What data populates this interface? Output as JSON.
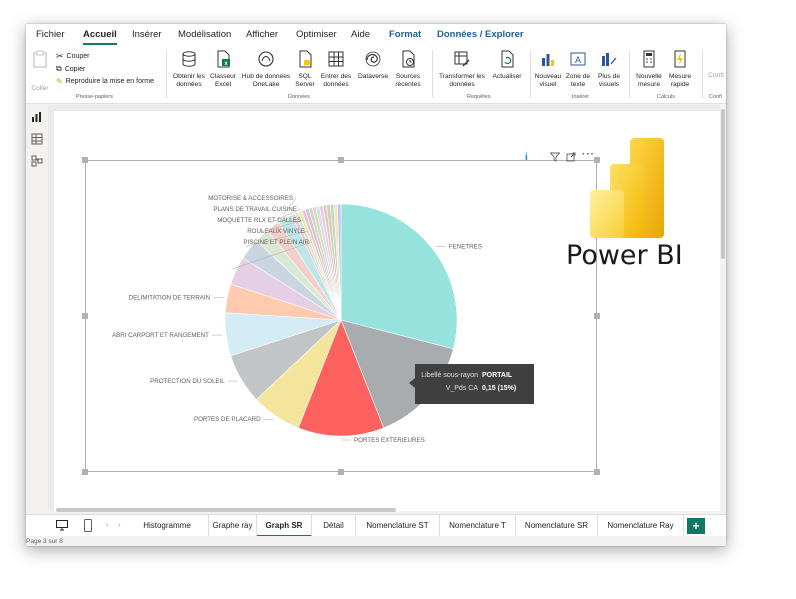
{
  "menu": {
    "tabs": [
      {
        "label": "Fichier"
      },
      {
        "label": "Accueil"
      },
      {
        "label": "Insérer"
      },
      {
        "label": "Modélisation"
      },
      {
        "label": "Afficher"
      },
      {
        "label": "Optimiser"
      },
      {
        "label": "Aide"
      },
      {
        "label": "Format"
      },
      {
        "label": "Données / Explorer"
      }
    ],
    "active": "Accueil"
  },
  "ribbon": {
    "clipboard": {
      "paste": "Coller",
      "cut": "Couper",
      "copy": "Copier",
      "format_painter": "Reproduire la mise en forme",
      "group": "Presse-papiers"
    },
    "data": {
      "get_data": "Obtenir les données",
      "excel": "Classeur Excel",
      "onelake": "Hub de données OneLake",
      "sql": "SQL Server",
      "enter": "Entrer des données",
      "dataverse": "Dataverse",
      "recent": "Sources récentes",
      "group": "Données"
    },
    "queries": {
      "transform": "Transformer les données",
      "refresh": "Actualiser",
      "group": "Requêtes"
    },
    "insert": {
      "new_visual": "Nouveau visuel",
      "text_box": "Zone de texte",
      "more_visuals": "Plus de visuels",
      "group": "Insérer"
    },
    "calculations": {
      "new_measure": "Nouvelle mesure",
      "quick_measure": "Mesure rapide",
      "group": "Calculs"
    },
    "sensitivity": {
      "label": "Confi",
      "group": "Confi"
    }
  },
  "chart_data": {
    "type": "pie",
    "categories": [
      "FENETRES",
      "PORTAIL",
      "PORTES EXTERIEURES",
      "PORTES DE PLACARD",
      "PROTECTION DU SOLEIL",
      "ABRI CARPORT ET RANGEMENT",
      "DELIMITATION DE TERRAIN",
      "PISCINE ET PLEIN AIR",
      "ROULEAUX VINYLE",
      "MOQUETTE RLX ET DALLES",
      "PLANS DE TRAVAIL CUISINE",
      "MOTORISE & ACCESSOIRES"
    ],
    "values": [
      0.29,
      0.15,
      0.12,
      0.07,
      0.07,
      0.06,
      0.04,
      0.04,
      0.03,
      0.02,
      0.02,
      0.02
    ],
    "other_share": 0.07,
    "colors": [
      "#96e2dc",
      "#a8acaf",
      "#fd625e",
      "#f5e49b",
      "#c2c5c6",
      "#d3ecf5",
      "#ffcaad",
      "#e5cfe5",
      "#cbd5e0",
      "#d9e7d4",
      "#f0d0c8",
      "#bde6e8"
    ],
    "other_colors": [
      "#f4c4c2",
      "#c9e7ea",
      "#fbe5a0",
      "#d6c9e6",
      "#f2b9b1",
      "#b7dfe0",
      "#e8d4b3",
      "#cfe0f2",
      "#f5cbd8",
      "#d0d0d0",
      "#e3c7a7",
      "#b8d9c8",
      "#f0e4c2",
      "#c6c6e6"
    ]
  },
  "tooltip": {
    "key1": "Libellé sous-rayon",
    "val1": "PORTAIL",
    "key2": "V_Pds CA",
    "val2": "0,15 (15%)"
  },
  "visual_header": {
    "info": "i"
  },
  "page_tabs": [
    {
      "label": "Histogramme"
    },
    {
      "label": "Graphe ray"
    },
    {
      "label": "Graph SR"
    },
    {
      "label": "Détail"
    },
    {
      "label": "Nomenclature ST"
    },
    {
      "label": "Nomenclature T"
    },
    {
      "label": "Nomenclature SR"
    },
    {
      "label": "Nomenclature Ray"
    }
  ],
  "active_page": "Graph SR",
  "status": "Page 3 sur 8",
  "logo_text": "Power BI",
  "colors": {
    "accent": "#117865",
    "logo_dark": "#e8a500",
    "logo_mid": "#f2c811",
    "logo_light": "#fbe067"
  }
}
